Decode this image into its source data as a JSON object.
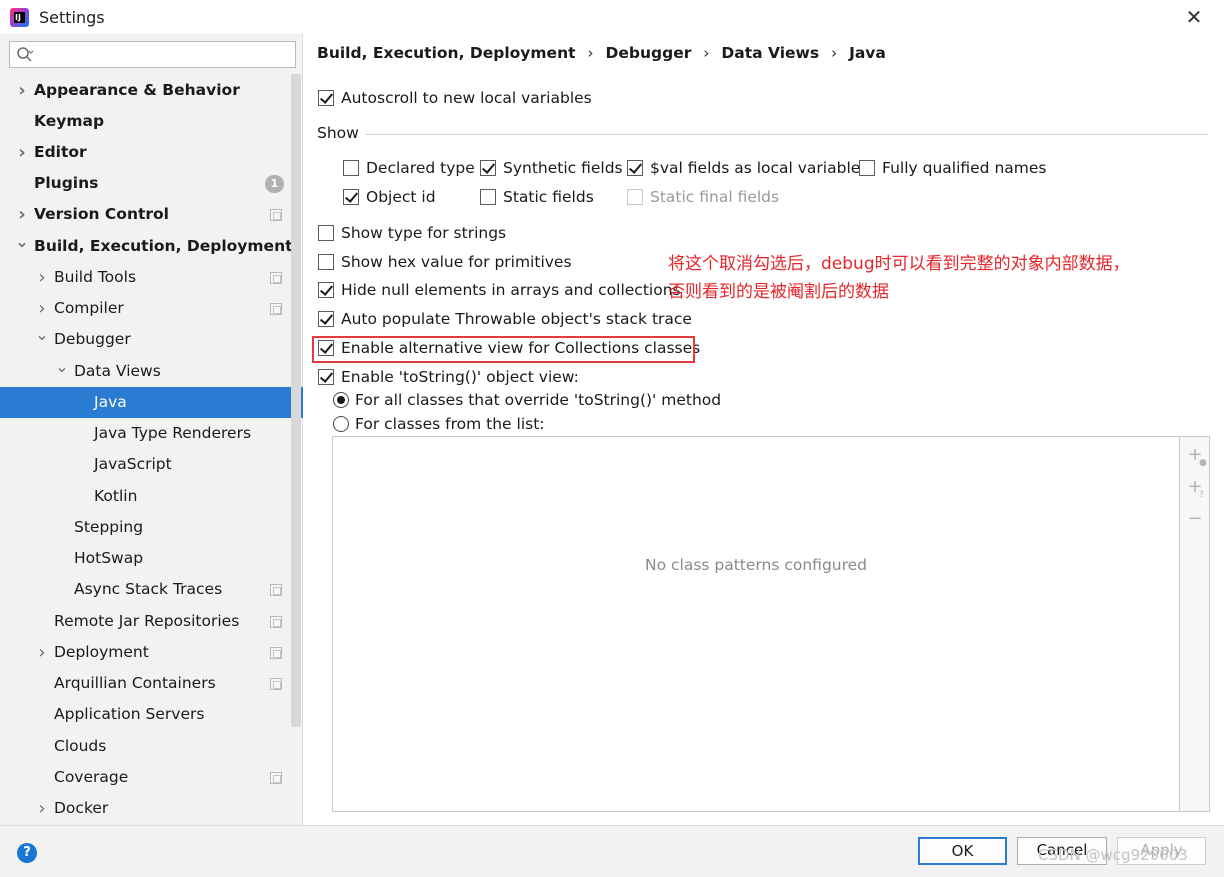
{
  "window": {
    "title": "Settings",
    "app_icon": "intellij-idea-icon",
    "close_icon": "close-icon"
  },
  "search": {
    "value": "",
    "placeholder": "",
    "icon": "search-icon"
  },
  "sidebar": {
    "items": [
      {
        "label": "Appearance & Behavior",
        "expand": "collapsed",
        "bold": true
      },
      {
        "label": "Keymap",
        "bold": true
      },
      {
        "label": "Editor",
        "expand": "collapsed",
        "bold": true
      },
      {
        "label": "Plugins",
        "bold": true,
        "badge": "1"
      },
      {
        "label": "Version Control",
        "expand": "collapsed",
        "bold": true,
        "project_icon": true
      },
      {
        "label": "Build, Execution, Deployment",
        "expand": "expanded",
        "bold": true
      },
      {
        "label": "Build Tools",
        "expand": "collapsed",
        "project_icon": true
      },
      {
        "label": "Compiler",
        "expand": "collapsed",
        "project_icon": true
      },
      {
        "label": "Debugger",
        "expand": "expanded"
      },
      {
        "label": "Data Views",
        "expand": "expanded"
      },
      {
        "label": "Java",
        "selected": true
      },
      {
        "label": "Java Type Renderers"
      },
      {
        "label": "JavaScript"
      },
      {
        "label": "Kotlin"
      },
      {
        "label": "Stepping"
      },
      {
        "label": "HotSwap"
      },
      {
        "label": "Async Stack Traces",
        "project_icon": true
      },
      {
        "label": "Remote Jar Repositories",
        "project_icon": true
      },
      {
        "label": "Deployment",
        "expand": "collapsed",
        "project_icon": true
      },
      {
        "label": "Arquillian Containers",
        "project_icon": true
      },
      {
        "label": "Application Servers"
      },
      {
        "label": "Clouds"
      },
      {
        "label": "Coverage",
        "project_icon": true
      },
      {
        "label": "Docker",
        "expand": "collapsed"
      }
    ]
  },
  "breadcrumb": {
    "items": [
      "Build, Execution, Deployment",
      "Debugger",
      "Data Views",
      "Java"
    ],
    "separator": "›"
  },
  "options": {
    "autoscroll": {
      "label": "Autoscroll to new local variables",
      "checked": true
    },
    "show_group": "Show",
    "declared_type": {
      "label": "Declared type",
      "checked": false
    },
    "synthetic_fields": {
      "label": "Synthetic fields",
      "checked": true
    },
    "val_fields": {
      "label": "$val fields as local variables",
      "checked": true
    },
    "fully_qualified": {
      "label": "Fully qualified names",
      "checked": false
    },
    "object_id": {
      "label": "Object id",
      "checked": true
    },
    "static_fields": {
      "label": "Static fields",
      "checked": false
    },
    "static_final_fields": {
      "label": "Static final fields",
      "checked": false,
      "disabled": true
    },
    "type_for_strings": {
      "label": "Show type for strings",
      "checked": false
    },
    "hex_primitives": {
      "label": "Show hex value for primitives",
      "checked": false
    },
    "hide_null": {
      "label": "Hide null elements in arrays and collections",
      "checked": true
    },
    "auto_populate": {
      "label": "Auto populate Throwable object's stack trace",
      "checked": true
    },
    "alt_view": {
      "label": "Enable alternative view for Collections classes",
      "checked": true
    },
    "tostring_view": {
      "label": "Enable 'toString()' object view:",
      "checked": true
    },
    "radio_all": {
      "label": "For all classes that override 'toString()' method",
      "selected": true
    },
    "radio_list": {
      "label": "For classes from the list:",
      "selected": false
    }
  },
  "annotation": {
    "line1": "将这个取消勾选后，debug时可以看到完整的对象内部数据，",
    "line2": "否则看到的是被阉割后的数据",
    "color": "#e6262a"
  },
  "class_list": {
    "empty_text": "No class patterns configured"
  },
  "buttons": {
    "ok": "OK",
    "cancel": "Cancel",
    "apply": "Apply",
    "help": "?"
  },
  "watermark": "CSDN @wcg929003",
  "colors": {
    "selection": "#2a7cd3",
    "highlight_box": "#e23b3b"
  }
}
